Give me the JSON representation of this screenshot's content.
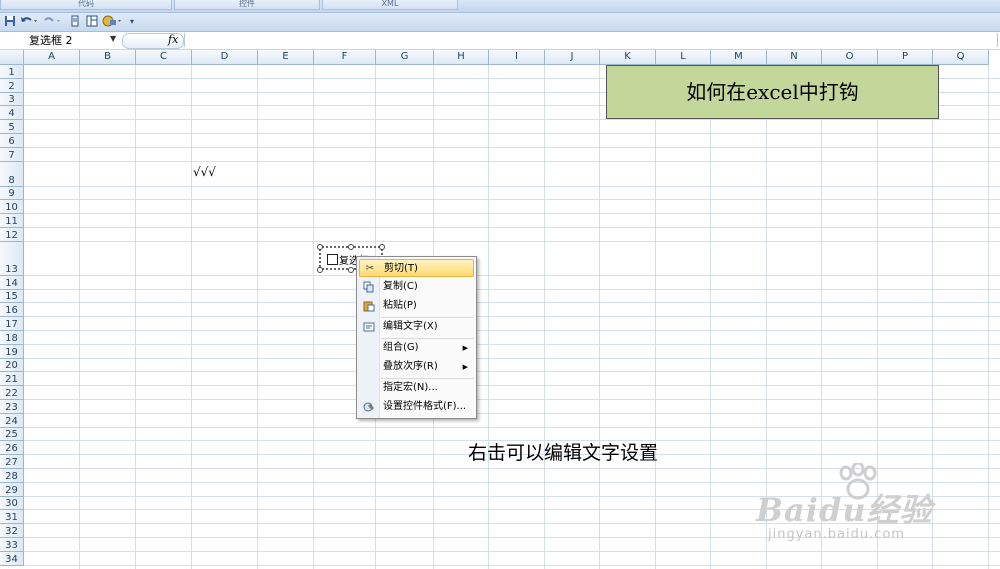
{
  "ribbon": {
    "tabs": [
      "代码",
      "控件",
      "XML"
    ]
  },
  "qat": {
    "buttons": [
      "save-icon",
      "undo-icon",
      "redo-icon",
      "print-icon",
      "form-icon",
      "tools-icon",
      "customize-icon"
    ]
  },
  "formula_bar": {
    "name_box": "复选框 2",
    "fx": "fx",
    "value": ""
  },
  "columns": [
    "A",
    "B",
    "C",
    "D",
    "E",
    "F",
    "G",
    "H",
    "I",
    "J",
    "K",
    "L",
    "M",
    "N",
    "O",
    "P",
    "Q"
  ],
  "rows": [
    "1",
    "2",
    "3",
    "4",
    "5",
    "6",
    "7",
    "8",
    "9",
    "10",
    "11",
    "12",
    "13",
    "14",
    "15",
    "16",
    "17",
    "18",
    "19",
    "20",
    "21",
    "22",
    "23",
    "24",
    "25",
    "26",
    "27",
    "28",
    "29",
    "30",
    "31",
    "32",
    "33",
    "34"
  ],
  "sheet": {
    "title_box": "如何在excel中打钩",
    "checkmarks": "√√√",
    "checkbox_label": "复选框",
    "caption": "右击可以编辑文字设置"
  },
  "context_menu": {
    "items": [
      {
        "label": "剪切(T)",
        "icon": "scissors-icon",
        "highlighted": true
      },
      {
        "label": "复制(C)",
        "icon": "copy-icon"
      },
      {
        "label": "粘贴(P)",
        "icon": "paste-icon"
      },
      {
        "label": "编辑文字(X)",
        "icon": "edit-text-icon"
      },
      {
        "label": "组合(G)",
        "submenu": true
      },
      {
        "label": "叠放次序(R)",
        "submenu": true
      },
      {
        "label": "指定宏(N)..."
      },
      {
        "label": "设置控件格式(F)...",
        "icon": "format-control-icon"
      }
    ]
  },
  "watermark": {
    "brand": "Baidu经验",
    "url": "jingyan.baidu.com"
  }
}
